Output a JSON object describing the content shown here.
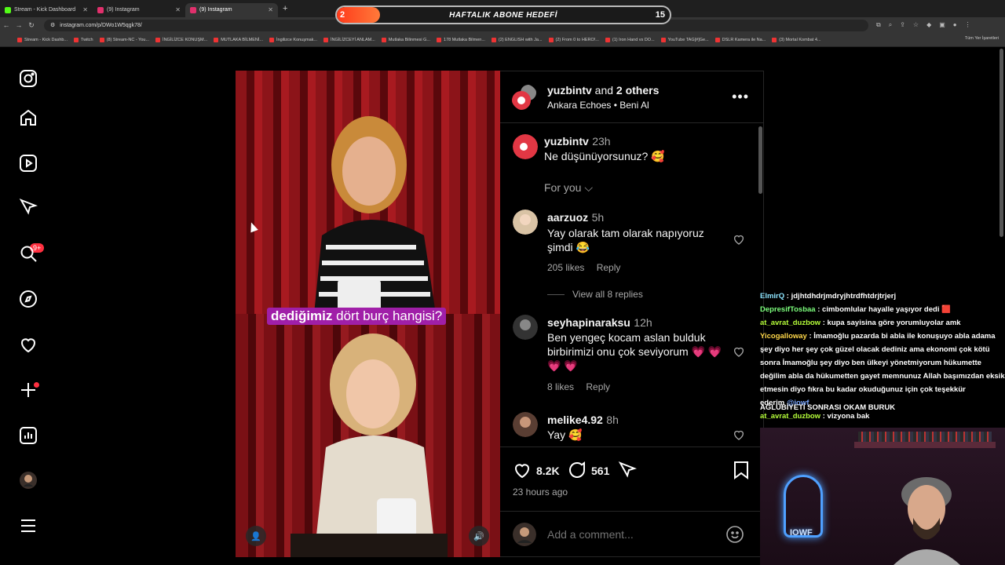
{
  "browser": {
    "tabs": [
      {
        "label": "Stream - Kick Dashboard",
        "icon": "kick-icon",
        "color": "#53fc18"
      },
      {
        "label": "(9) Instagram",
        "icon": "instagram-icon",
        "color": "#e1306c"
      },
      {
        "label": "(9) Instagram",
        "icon": "instagram-icon",
        "color": "#e1306c"
      }
    ],
    "url": "instagram.com/p/DWo1W5qgk78/",
    "bookmarks": [
      "Stream - Kick Dashb...",
      "Twitch",
      "(8) Stream-NC - You...",
      "İNGİLİZCE KONUŞM...",
      "MUTLAKA BİLMENİ...",
      "İngilizce Konuşmak...",
      "İNGİLİZCEYİ ANLAM...",
      "Mutlaka Bilinmesi G...",
      "178 Mutlaka Bilmen...",
      "(2) ENGLISH with Ja...",
      "(2) From 0 to HERO!...",
      "(1) Iron Hand vs DO...",
      "YouTube TAG[#]Ge...",
      "DSLR Kamera ile Na...",
      "(3) Mortal Kombat 4..."
    ],
    "bookmarks_all": "Tüm Yer İşaretleri"
  },
  "overlay": {
    "left": "2",
    "title": "HAFTALIK ABONE HEDEFİ",
    "right": "15",
    "progress": 0.13
  },
  "post": {
    "caption_bold": "dediğimiz",
    "caption_rest": " dört burç hangisi?",
    "header": {
      "user": "yuzbintv",
      "and": " and ",
      "others": "2 others",
      "music": "Ankara Echoes • Beni Al"
    },
    "main_comment": {
      "user": "yuzbintv",
      "time": "23h",
      "text": "Ne düşünüyorsunuz? 🥰"
    },
    "sort_label": "For you",
    "comments": [
      {
        "user": "aarzuoz",
        "time": "5h",
        "text": "Yay olarak tam olarak napıyoruz şimdi 😂",
        "likes": "205 likes",
        "reply": "Reply",
        "view_replies": "View all 8 replies"
      },
      {
        "user": "seyhapinaraksu",
        "time": "12h",
        "text": "Ben yengeç kocam aslan bulduk birbirimizi onu çok seviyorum 💗 💗 💗 💗",
        "likes": "8 likes",
        "reply": "Reply"
      },
      {
        "user": "melike4.92",
        "time": "8h",
        "text": "Yay 🥰"
      }
    ],
    "like_count": "8.2K",
    "comment_count": "561",
    "posted_ago": "23 hours ago",
    "add_comment_placeholder": "Add a comment..."
  },
  "sidebar": {
    "messages_badge": "9+"
  },
  "chat": [
    {
      "user": "ElmirQ",
      "msg": "jdjhtdhdrjmdryjhtrdfhtdrjtrjerj",
      "cls": "u1"
    },
    {
      "user": "DepresifTosbaa",
      "msg": "cimbomlular hayalle yaşıyor dedi 🟥",
      "cls": "u2"
    },
    {
      "user": "at_avrat_duzbow",
      "msg": "kupa sayisina göre yorumluyolar amk",
      "cls": "u3"
    },
    {
      "user": "Yicogalloway",
      "msg": "İmamoğlu pazarda bi abla ile konuşuyo abla adama şey diyo her şey çok güzel olacak dediniz ama ekonomi çok kötü sonra İmamoğlu şey diyo ben ülkeyi yönetmiyorum hükumette değilim abla da hükumetten gayet memnunuz Allah başımızdan eksik etmesin diyo fıkra bu kadar okuduğunuz için çok teşekkür ederim",
      "link": "@iowf",
      "cls": "u4"
    },
    {
      "user": "at_avrat_duzbow",
      "msg": "vizyona bak",
      "cls": "u3"
    }
  ],
  "ticker": "AĞLUBİYETİ SONRASI OKAM BURUK",
  "cam_sign": "IOWF"
}
